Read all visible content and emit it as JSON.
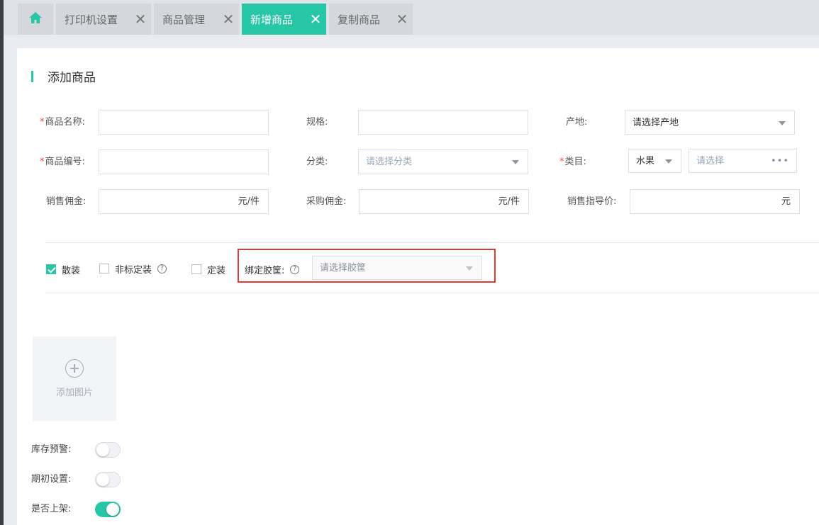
{
  "tabs": [
    {
      "label": "",
      "icon": "home-icon",
      "active": false
    },
    {
      "label": "打印机设置",
      "close": "✕",
      "active": false
    },
    {
      "label": "商品管理",
      "close": "✕",
      "active": false
    },
    {
      "label": "新增商品",
      "close": "✕",
      "active": true
    },
    {
      "label": "复制商品",
      "close": "✕",
      "active": false
    }
  ],
  "page_title": "添加商品",
  "form": {
    "product_name": {
      "required": "*",
      "label": "商品名称:",
      "value": ""
    },
    "spec": {
      "label": "规格:",
      "value": ""
    },
    "origin": {
      "label": "产地:",
      "value": "请选择产地"
    },
    "product_code": {
      "required": "*",
      "label": "商品编号:",
      "value": ""
    },
    "category": {
      "label": "分类:",
      "placeholder": "请选择分类"
    },
    "type": {
      "required": "*",
      "label": "类目:",
      "value": "水果",
      "sub_placeholder": "请选择",
      "more": "•••"
    },
    "sales_commission": {
      "label": "销售佣金:",
      "value": "",
      "suffix": "元/件"
    },
    "purchase_commission": {
      "label": "采购佣金:",
      "value": "",
      "suffix": "元/件"
    },
    "guide_price": {
      "label": "销售指导价:",
      "value": "",
      "suffix": "元"
    }
  },
  "packaging": {
    "bulk": {
      "label": "散装",
      "checked": true
    },
    "non_standard": {
      "label": "非标定装",
      "checked": false,
      "help": "?"
    },
    "fixed": {
      "label": "定装",
      "checked": false
    },
    "bind_basket": {
      "label": "绑定胶筐:",
      "help": "?",
      "placeholder": "请选择胶筐"
    }
  },
  "upload": {
    "label": "添加图片"
  },
  "switches": [
    {
      "label": "库存预警:",
      "on": false
    },
    {
      "label": "期初设置:",
      "on": false
    },
    {
      "label": "是否上架:",
      "on": true
    }
  ],
  "colors": {
    "accent": "#26c6a6",
    "highlight": "#e53935",
    "required": "#f04848"
  }
}
